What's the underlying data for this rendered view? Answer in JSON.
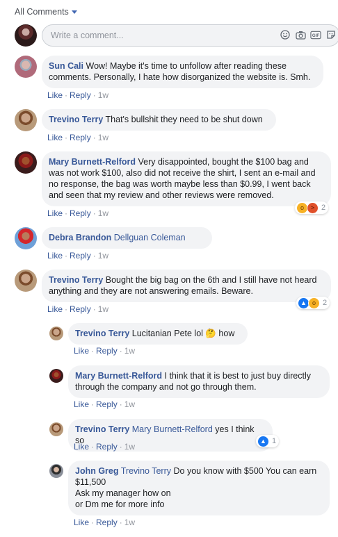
{
  "header": {
    "label": "All Comments"
  },
  "composer": {
    "placeholder": "Write a comment...",
    "icons": [
      "emoji-icon",
      "camera-icon",
      "gif-icon",
      "sticker-icon"
    ]
  },
  "actions": {
    "like": "Like",
    "reply": "Reply"
  },
  "comments": [
    {
      "name": "Sun Cali",
      "text": "Wow! Maybe it's time to unfollow after reading these comments. Personally, I hate how disorganized the website is. Smh.",
      "time": "1w"
    },
    {
      "name": "Trevino Terry",
      "text": "That's bullshit they need to be shut down",
      "time": "1w"
    },
    {
      "name": "Mary Burnett-Relford",
      "text": "Very disappointed, bought the $100 bag and was not work $100, also did not receive the shirt, I sent an e-mail and no response, the bag was worth maybe less than $0.99, I went back and seen that my review and other reviews were removed.",
      "time": "1w",
      "reactions": {
        "count": "2"
      }
    },
    {
      "name": "Debra Brandon",
      "tag": "Dellguan Coleman",
      "text": "",
      "time": "1w"
    },
    {
      "name": "Trevino Terry",
      "text": "Bought the big bag on the 6th and I still have not heard anything and they are not answering emails. Beware.",
      "time": "1w",
      "reactions": {
        "count": "2"
      }
    }
  ],
  "replies": [
    {
      "name": "Trevino Terry",
      "text": "Lucitanian Pete lol 🤔 how",
      "time": "1w"
    },
    {
      "name": "Mary Burnett-Relford",
      "text": "I think that it is best to just buy directly through the company and not go through them.",
      "time": "1w"
    },
    {
      "name": "Trevino Terry",
      "tag": "Mary Burnett-Relford",
      "text": "yes I think so",
      "time": "1w",
      "reactions": {
        "count": "1"
      }
    },
    {
      "name": "John Greg",
      "tag": "Trevino Terry",
      "text": "Do you know with $500 You can earn $11,500",
      "text2": "Ask my manager how on",
      "text3": "or Dm me for more info",
      "time": "1w"
    }
  ]
}
